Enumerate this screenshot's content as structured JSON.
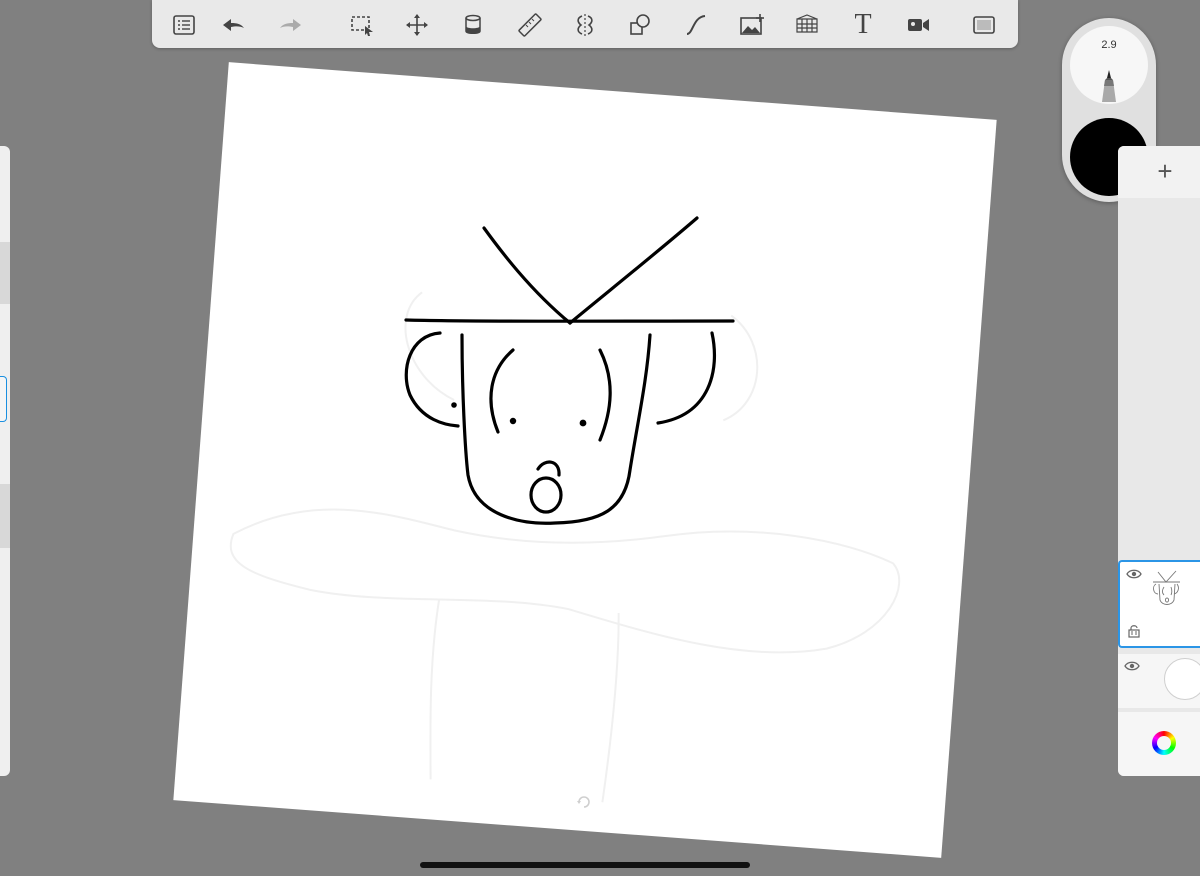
{
  "toolbar": {
    "items": [
      {
        "name": "layers-list-icon"
      },
      {
        "name": "undo-icon"
      },
      {
        "name": "redo-icon"
      },
      {
        "name": "selection-icon"
      },
      {
        "name": "transform-icon"
      },
      {
        "name": "fill-bucket-icon"
      },
      {
        "name": "ruler-icon"
      },
      {
        "name": "symmetry-icon"
      },
      {
        "name": "shapes-icon"
      },
      {
        "name": "curve-icon"
      },
      {
        "name": "import-image-icon"
      },
      {
        "name": "perspective-grid-icon"
      },
      {
        "name": "text-icon"
      },
      {
        "name": "record-icon"
      },
      {
        "name": "fullscreen-icon"
      }
    ],
    "text_tool_label": "T"
  },
  "brush": {
    "size": "2.9",
    "color": "#000000"
  },
  "layers": {
    "add_label": "+",
    "items": [
      {
        "name": "drawing-layer",
        "visible": true,
        "selected": true
      },
      {
        "name": "background-layer",
        "visible": true,
        "selected": false
      }
    ]
  },
  "colors": {
    "accent": "#2b95e6",
    "canvas": "#ffffff",
    "workspace": "#808080"
  }
}
